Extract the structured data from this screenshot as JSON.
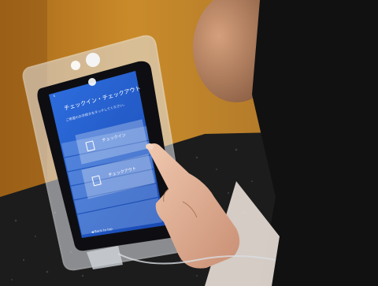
{
  "screen": {
    "title": "チェックイン・チェックアウト",
    "description": "ご希望のお手続きをタッチしてください。",
    "options": [
      {
        "label": "チェックイン"
      },
      {
        "label": "チェックアウト"
      }
    ],
    "back_label": "◀ Back to top"
  },
  "colors": {
    "screen_blue": "#1f5fd0",
    "button_white": "#e8f0fb",
    "wall_orange": "#c9861e",
    "counter_dark": "#1b1b1b"
  }
}
